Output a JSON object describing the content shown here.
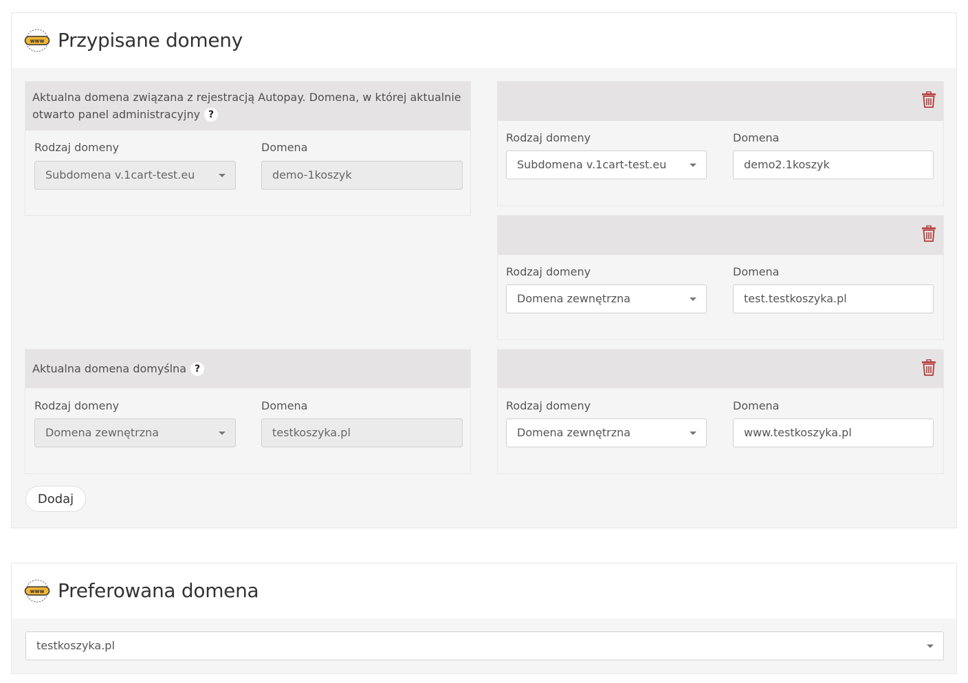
{
  "assigned": {
    "title": "Przypisane domeny",
    "current_registration": {
      "header": "Aktualna domena związana z rejestracją Autopay. Domena, w której aktualnie otwarto panel administracyjny",
      "help": "?",
      "type_label": "Rodzaj domeny",
      "type_value": "Subdomena v.1cart-test.eu",
      "domain_label": "Domena",
      "domain_value": "demo-1koszyk"
    },
    "current_default": {
      "header": "Aktualna domena domyślna",
      "help": "?",
      "type_label": "Rodzaj domeny",
      "type_value": "Domena zewnętrzna",
      "domain_label": "Domena",
      "domain_value": "testkoszyka.pl"
    },
    "extra": [
      {
        "type_label": "Rodzaj domeny",
        "type_value": "Subdomena v.1cart-test.eu",
        "domain_label": "Domena",
        "domain_value": "demo2.1koszyk"
      },
      {
        "type_label": "Rodzaj domeny",
        "type_value": "Domena zewnętrzna",
        "domain_label": "Domena",
        "domain_value": "test.testkoszyka.pl"
      },
      {
        "type_label": "Rodzaj domeny",
        "type_value": "Domena zewnętrzna",
        "domain_label": "Domena",
        "domain_value": "www.testkoszyka.pl"
      }
    ],
    "add_label": "Dodaj"
  },
  "preferred": {
    "title": "Preferowana domena",
    "value": "testkoszyka.pl"
  },
  "icons": {
    "www": "www-icon",
    "trash": "trash-icon",
    "caret": "chevron-down-icon"
  },
  "colors": {
    "trash": "#b53a3a",
    "www_badge": "#f2b632",
    "card_header": "#e5e3e3"
  }
}
